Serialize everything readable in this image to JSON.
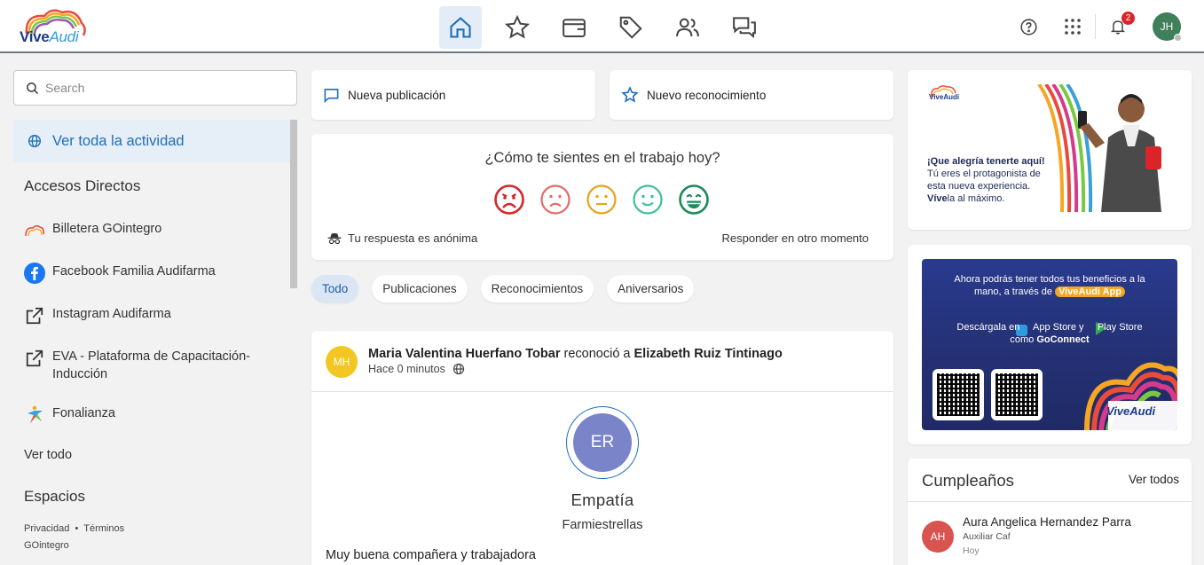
{
  "header": {
    "logo_primary": "Vive",
    "logo_secondary": "Audi",
    "notification_count": "2",
    "user_initials": "JH",
    "nav_icons": [
      "home-icon",
      "star-icon",
      "wallet-icon",
      "tag-icon",
      "people-icon",
      "chat-icon"
    ]
  },
  "sidebar": {
    "search_placeholder": "Search",
    "activity_label": "Ver toda la actividad",
    "shortcuts_title": "Accesos Directos",
    "shortcuts": [
      {
        "label": "Billetera GOintegro",
        "icon": "rainbow-logo-icon"
      },
      {
        "label": "Facebook Familia Audifarma",
        "icon": "facebook-icon"
      },
      {
        "label": "Instagram Audifarma",
        "icon": "external-link-icon"
      },
      {
        "label": "EVA - Plataforma de Capacitación-Inducción",
        "icon": "external-link-icon"
      },
      {
        "label": "Fonalianza",
        "icon": "fonalianza-logo-icon"
      }
    ],
    "see_all": "Ver todo",
    "spaces_title": "Espacios",
    "footer": {
      "privacy": "Privacidad",
      "terms": "Términos",
      "brand": "GOintegro"
    }
  },
  "composer": {
    "new_post": "Nueva publicación",
    "new_recognition": "Nuevo reconocimiento"
  },
  "mood": {
    "question": "¿Cómo te sientes en el trabajo hoy?",
    "anonymous": "Tu respuesta es anónima",
    "later": "Responder en otro momento",
    "colors": [
      "#d9252a",
      "#e66a6a",
      "#e8a317",
      "#3fbf9a",
      "#1a8a5a"
    ]
  },
  "filters": [
    "Todo",
    "Publicaciones",
    "Reconocimientos",
    "Aniversarios"
  ],
  "post": {
    "author_initials": "MH",
    "author": "Maria Valentina Huerfano Tobar",
    "verb": "reconoció a",
    "recipient": "Elizabeth Ruiz Tintinago",
    "time": "Hace 0 minutos",
    "recipient_initials": "ER",
    "value": "Empatía",
    "category": "Farmiestrellas",
    "message": "Muy buena compañera y trabajadora"
  },
  "banners": {
    "b1_logo": "ViveAudi",
    "b1_line1": "¡Que alegría tenerte aquí!",
    "b1_line2": "Tú eres el protagonista de",
    "b1_line3": "esta nueva experiencia.",
    "b1_line4_bold": "Víve",
    "b1_line4_rest": "la al máximo.",
    "b2_line1": "Ahora podrás tener todos tus beneficios a la",
    "b2_line2": "mano, a través de",
    "b2_highlight": "ViveAudi App",
    "b2_line3_a": "Descárgala en",
    "b2_appstore": "App Store y",
    "b2_playstore": "Play Store",
    "b2_line4": "como",
    "b2_goconnect": "GoConnect",
    "b2_logo": "ViveAudi"
  },
  "birthdays": {
    "title": "Cumpleaños",
    "see_all": "Ver todos",
    "person_initials": "AH",
    "person_name": "Aura Angelica Hernandez Parra",
    "person_role": "Auxiliar Caf",
    "when": "Hoy"
  }
}
